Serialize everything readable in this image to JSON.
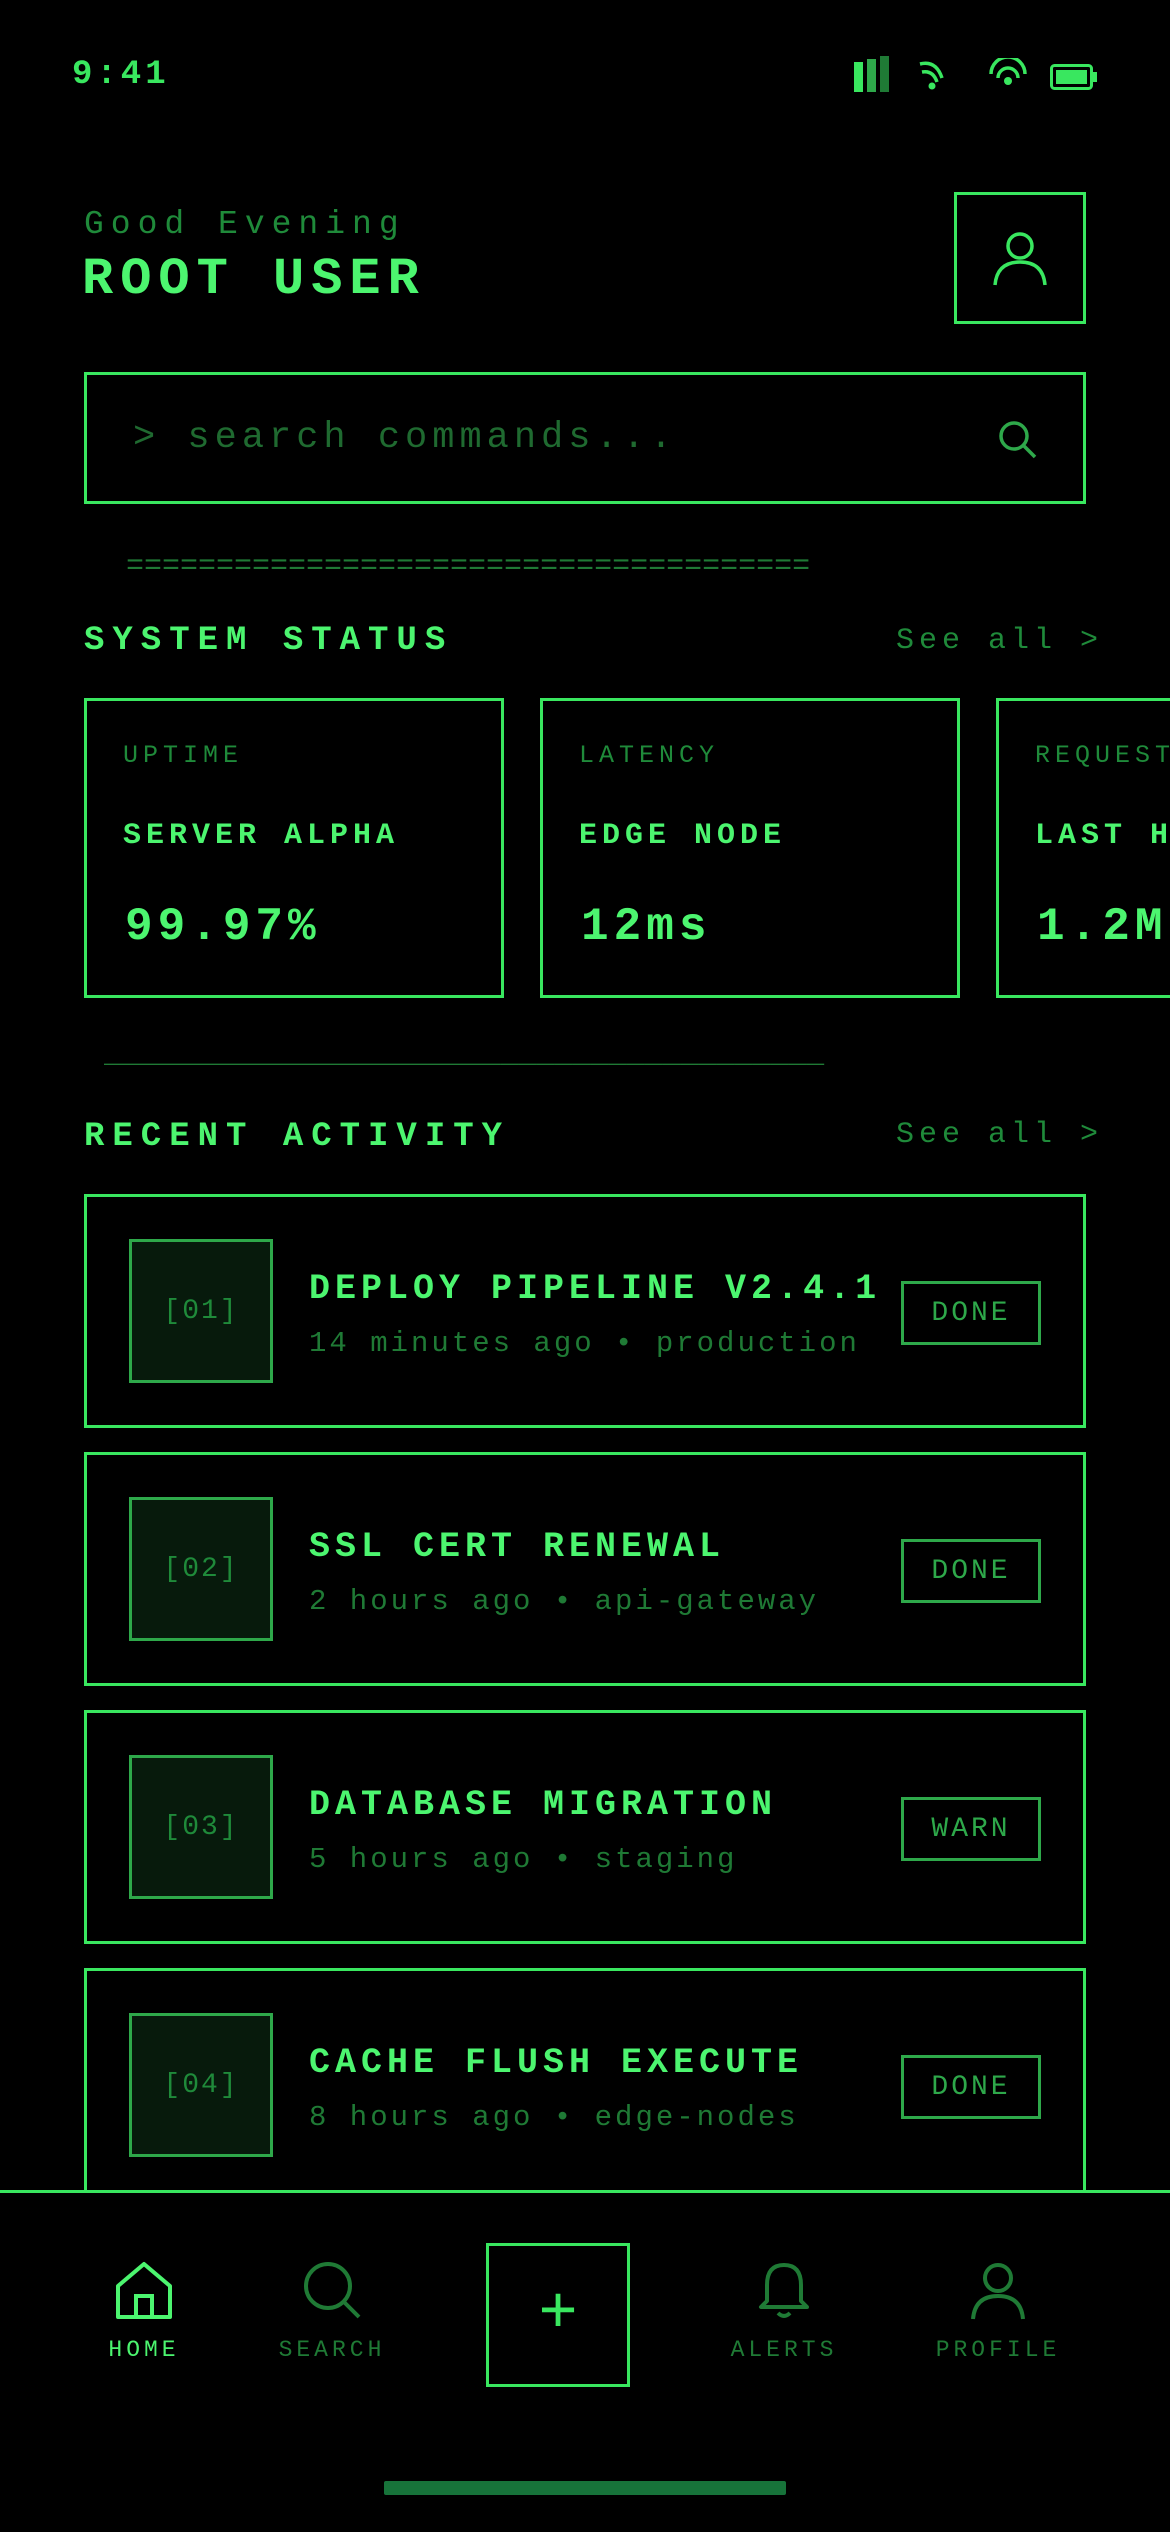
{
  "status_bar": {
    "time": "9:41"
  },
  "header": {
    "greeting": "Good Evening",
    "username": "ROOT USER"
  },
  "search": {
    "placeholder": "> search commands..."
  },
  "dividers": {
    "top": "======================================",
    "middle": "________________________________________"
  },
  "system_status": {
    "title": "SYSTEM STATUS",
    "see_all": "See all >",
    "cards": [
      {
        "label": "UPTIME",
        "name": "SERVER ALPHA",
        "value": "99.97%"
      },
      {
        "label": "LATENCY",
        "name": "EDGE NODE",
        "value": "12ms"
      },
      {
        "label": "REQUESTS",
        "name": "LAST HOUR",
        "value": "1.2M"
      }
    ]
  },
  "recent_activity": {
    "title": "RECENT ACTIVITY",
    "see_all": "See all >",
    "items": [
      {
        "index": "[01]",
        "title": "DEPLOY PIPELINE V2.4.1",
        "meta": "14 minutes ago • production",
        "status": "DONE"
      },
      {
        "index": "[02]",
        "title": "SSL CERT RENEWAL",
        "meta": "2 hours ago • api-gateway",
        "status": "DONE"
      },
      {
        "index": "[03]",
        "title": "DATABASE MIGRATION",
        "meta": "5 hours ago • staging",
        "status": "WARN"
      },
      {
        "index": "[04]",
        "title": "CACHE FLUSH EXECUTE",
        "meta": "8 hours ago • edge-nodes",
        "status": "DONE"
      }
    ]
  },
  "tabbar": {
    "home": "HOME",
    "search": "SEARCH",
    "fab": "+",
    "alerts": "ALERTS",
    "profile": "PROFILE",
    "active": "home"
  },
  "icons": {
    "signal": "signal-icon",
    "wifi": "wifi-icon",
    "hotspot": "hotspot-icon",
    "battery": "battery-icon",
    "avatar": "user-icon",
    "search": "search-icon",
    "home": "home-icon",
    "bell": "bell-icon",
    "plus": "plus-icon"
  },
  "colors": {
    "accent": "#39e75f",
    "bright": "#4cf56f",
    "dim": "#1f7a35",
    "background": "#000000"
  }
}
